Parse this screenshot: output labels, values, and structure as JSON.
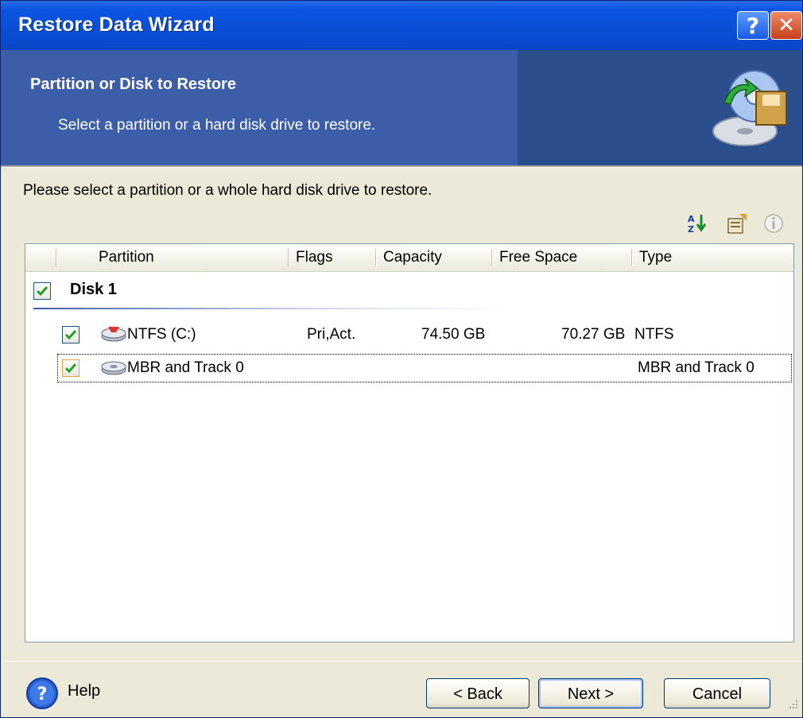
{
  "window": {
    "title": "Restore Data Wizard",
    "help_button_label": "?",
    "close_button_label": "✕"
  },
  "header": {
    "title": "Partition or Disk to Restore",
    "subtitle": "Select a partition or a hard disk drive to restore.",
    "icon": "restore-disk-icon"
  },
  "instruction": "Please select a partition or a whole hard disk drive to restore.",
  "toolbar": {
    "icons": [
      "sort-icon",
      "properties-icon",
      "info-icon"
    ]
  },
  "list": {
    "columns": [
      "Partition",
      "Flags",
      "Capacity",
      "Free Space",
      "Type"
    ],
    "disk": {
      "label": "Disk 1",
      "checked": true
    },
    "rows": [
      {
        "partition": "NTFS (C:)",
        "flags": "Pri,Act.",
        "capacity": "74.50 GB",
        "free_space": "70.27 GB",
        "type": "NTFS",
        "checked": true,
        "icon": "partition-icon"
      },
      {
        "partition": "MBR and Track 0",
        "flags": "",
        "capacity": "",
        "free_space": "",
        "type": "MBR and Track 0",
        "checked": true,
        "icon": "mbr-icon",
        "focused": true
      }
    ]
  },
  "footer": {
    "help_label": "Help",
    "back_label": "< Back",
    "next_label": "Next >",
    "cancel_label": "Cancel"
  },
  "colors": {
    "titlebar": "#0a4fd6",
    "banner": "#3c5ea8",
    "banner_dark": "#2b4f8c",
    "checkmark": "#21a121"
  }
}
